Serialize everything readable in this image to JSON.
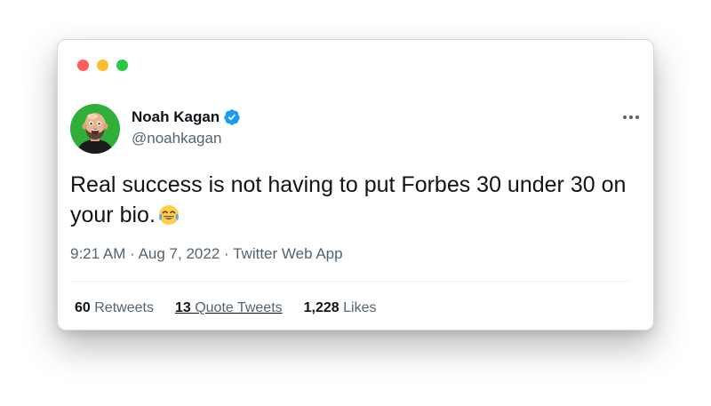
{
  "window": {
    "controls": [
      "close",
      "minimize",
      "maximize"
    ]
  },
  "tweet": {
    "author_name": "Noah Kagan",
    "author_handle": "@noahkagan",
    "verified": true,
    "text": "Real success is not having to put Forbes 30 under 30 on your bio.",
    "emoji": "face-with-tears-of-joy",
    "time": "9:21 AM",
    "date": "Aug 7, 2022",
    "source": "Twitter Web App",
    "meta_separator": "·",
    "stats": {
      "retweets_count": "60",
      "retweets_label": "Retweets",
      "quote_count": "13",
      "quote_label": "Quote Tweets",
      "likes_count": "1,228",
      "likes_label": "Likes"
    }
  },
  "colors": {
    "text_primary": "#0f1419",
    "text_secondary": "#536471",
    "verified_blue": "#1d9bf0",
    "avatar_bg": "#2fae3a"
  }
}
